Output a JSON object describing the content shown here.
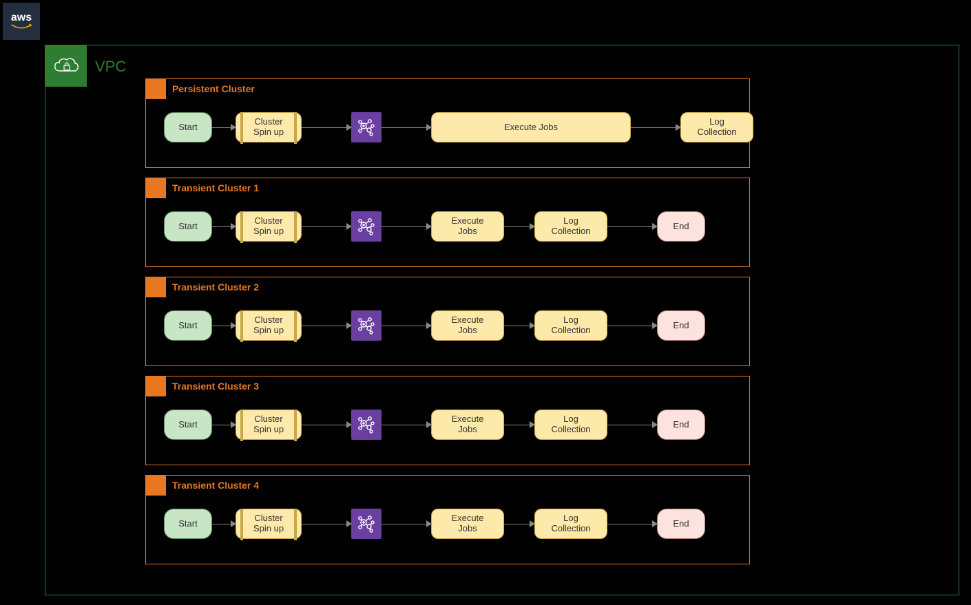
{
  "aws": {
    "text": "aws"
  },
  "vpc": {
    "label": "VPC"
  },
  "node_labels": {
    "start": "Start",
    "spinup_1": "Cluster",
    "spinup_2": "Spin up",
    "exec_wide": "Execute Jobs",
    "exec_1": "Execute",
    "exec_2": "Jobs",
    "log_1": "Log",
    "log_2": "Collection",
    "end": "End"
  },
  "clusters": [
    {
      "title": "Persistent  Cluster",
      "type": "persistent"
    },
    {
      "title": "Transient Cluster 1",
      "type": "transient"
    },
    {
      "title": "Transient Cluster 2",
      "type": "transient"
    },
    {
      "title": "Transient Cluster 3",
      "type": "transient"
    },
    {
      "title": "Transient Cluster 4",
      "type": "transient"
    }
  ],
  "colors": {
    "bg": "#000000",
    "aws_badge": "#232f3e",
    "vpc_green": "#2e7d32",
    "orange": "#e87722",
    "purple": "#6b3fa0",
    "yellow_fill": "#fde9aa",
    "green_fill": "#c8e6c5",
    "pink_fill": "#fce3de"
  }
}
